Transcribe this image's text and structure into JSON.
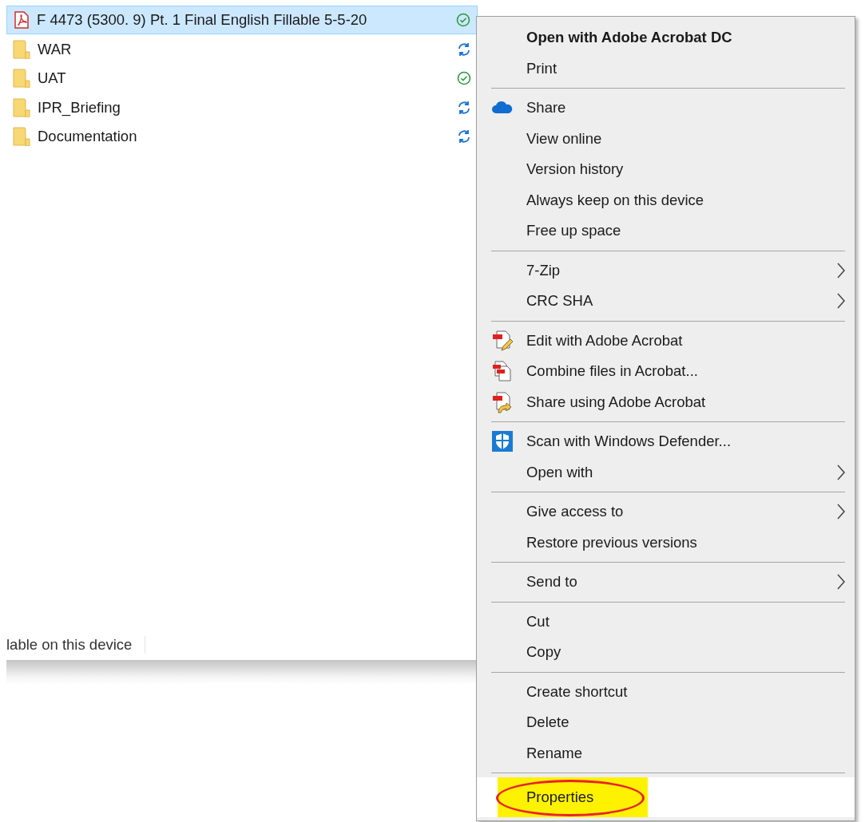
{
  "files": [
    {
      "name": "F 4473 (5300. 9) Pt. 1 Final English Fillable 5-5-20",
      "kind": "pdf",
      "synced": true,
      "selected": true
    },
    {
      "name": "WAR",
      "kind": "folder",
      "synced": false,
      "selected": false
    },
    {
      "name": "UAT",
      "kind": "folder",
      "synced": true,
      "selected": false
    },
    {
      "name": "IPR_Briefing",
      "kind": "folder",
      "synced": false,
      "selected": false
    },
    {
      "name": "Documentation",
      "kind": "folder",
      "synced": false,
      "selected": false
    }
  ],
  "status_bar": {
    "text": "lable on this device"
  },
  "context_menu": [
    {
      "kind": "plain",
      "label": "Open with Adobe Acrobat DC",
      "bold": true
    },
    {
      "kind": "plain",
      "label": "Print"
    },
    {
      "kind": "separator"
    },
    {
      "kind": "cloud",
      "label": "Share"
    },
    {
      "kind": "plain",
      "label": "View online"
    },
    {
      "kind": "plain",
      "label": "Version history"
    },
    {
      "kind": "plain",
      "label": "Always keep on this device"
    },
    {
      "kind": "plain",
      "label": "Free up space"
    },
    {
      "kind": "separator"
    },
    {
      "kind": "plain",
      "label": "7-Zip",
      "submenu": true
    },
    {
      "kind": "plain",
      "label": "CRC SHA",
      "submenu": true
    },
    {
      "kind": "separator"
    },
    {
      "kind": "edit",
      "label": "Edit with Adobe Acrobat"
    },
    {
      "kind": "combine",
      "label": "Combine files in Acrobat..."
    },
    {
      "kind": "forward",
      "label": "Share using Adobe Acrobat"
    },
    {
      "kind": "separator"
    },
    {
      "kind": "shield",
      "label": "Scan with Windows Defender..."
    },
    {
      "kind": "plain",
      "label": "Open with",
      "submenu": true
    },
    {
      "kind": "separator"
    },
    {
      "kind": "plain",
      "label": "Give access to",
      "submenu": true
    },
    {
      "kind": "plain",
      "label": "Restore previous versions"
    },
    {
      "kind": "separator"
    },
    {
      "kind": "plain",
      "label": "Send to",
      "submenu": true
    },
    {
      "kind": "separator"
    },
    {
      "kind": "plain",
      "label": "Cut"
    },
    {
      "kind": "plain",
      "label": "Copy"
    },
    {
      "kind": "separator"
    },
    {
      "kind": "plain",
      "label": "Create shortcut"
    },
    {
      "kind": "plain",
      "label": "Delete"
    },
    {
      "kind": "plain",
      "label": "Rename"
    },
    {
      "kind": "separator"
    },
    {
      "kind": "plain",
      "label": "Properties",
      "highlighted": true
    }
  ]
}
